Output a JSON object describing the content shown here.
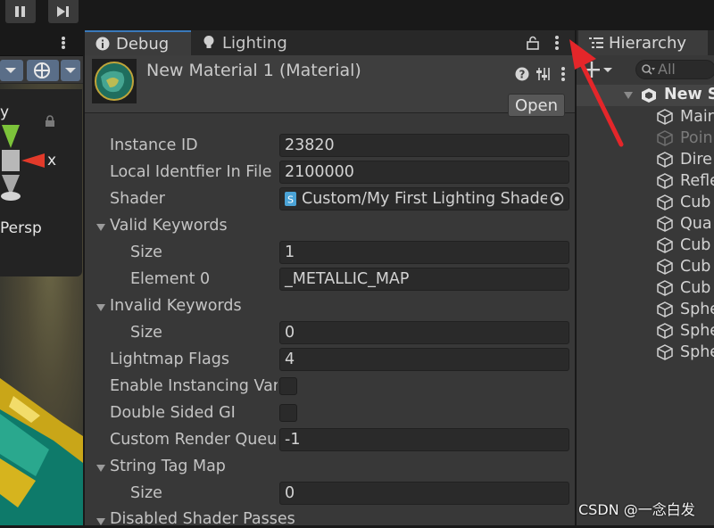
{
  "toolbar": {
    "pause_icon": "pause-icon",
    "step_icon": "step-icon"
  },
  "scene": {
    "axis_y": "y",
    "axis_x": "x",
    "projection_label": "Persp"
  },
  "inspector": {
    "tabs": [
      {
        "label": "Debug",
        "icon": "info-icon"
      },
      {
        "label": "Lighting",
        "icon": "lightbulb-icon"
      }
    ],
    "material_title": "New Material 1 (Material)",
    "open_button": "Open",
    "properties": {
      "instance_id": {
        "label": "Instance ID",
        "value": "23820"
      },
      "local_identifier": {
        "label": "Local Identfier In File",
        "value": "2100000"
      },
      "shader": {
        "label": "Shader",
        "value": "Custom/My First Lighting Shader"
      },
      "valid_keywords": {
        "label": "Valid Keywords",
        "size_label": "Size",
        "size_value": "1",
        "element_label": "Element 0",
        "element_value": "_METALLIC_MAP"
      },
      "invalid_keywords": {
        "label": "Invalid Keywords",
        "size_label": "Size",
        "size_value": "0"
      },
      "lightmap_flags": {
        "label": "Lightmap Flags",
        "value": "4"
      },
      "enable_instancing": {
        "label": "Enable Instancing Variants",
        "checked": false
      },
      "double_sided_gi": {
        "label": "Double Sided GI",
        "checked": false
      },
      "custom_render_queue": {
        "label": "Custom Render Queue",
        "value": "-1"
      },
      "string_tag_map": {
        "label": "String Tag Map",
        "size_label": "Size",
        "size_value": "0"
      },
      "disabled_shader_passes": {
        "label": "Disabled Shader Passes"
      }
    }
  },
  "hierarchy": {
    "tab_label": "Hierarchy",
    "search_placeholder": "All",
    "scene_name": "New S",
    "items": [
      {
        "label": "Mair",
        "disabled": false
      },
      {
        "label": "Poin",
        "disabled": true
      },
      {
        "label": "Dire",
        "disabled": false
      },
      {
        "label": "Refle",
        "disabled": false
      },
      {
        "label": "Cub",
        "disabled": false
      },
      {
        "label": "Qua",
        "disabled": false
      },
      {
        "label": "Cub",
        "disabled": false
      },
      {
        "label": "Cub",
        "disabled": false
      },
      {
        "label": "Cub",
        "disabled": false
      },
      {
        "label": "Sphe",
        "disabled": false
      },
      {
        "label": "Sphe",
        "disabled": false
      },
      {
        "label": "Sphe",
        "disabled": false
      }
    ]
  },
  "watermark": "CSDN @一念白发",
  "colors": {
    "accent": "#3a79bb",
    "annotation_arrow": "#e4262a"
  }
}
